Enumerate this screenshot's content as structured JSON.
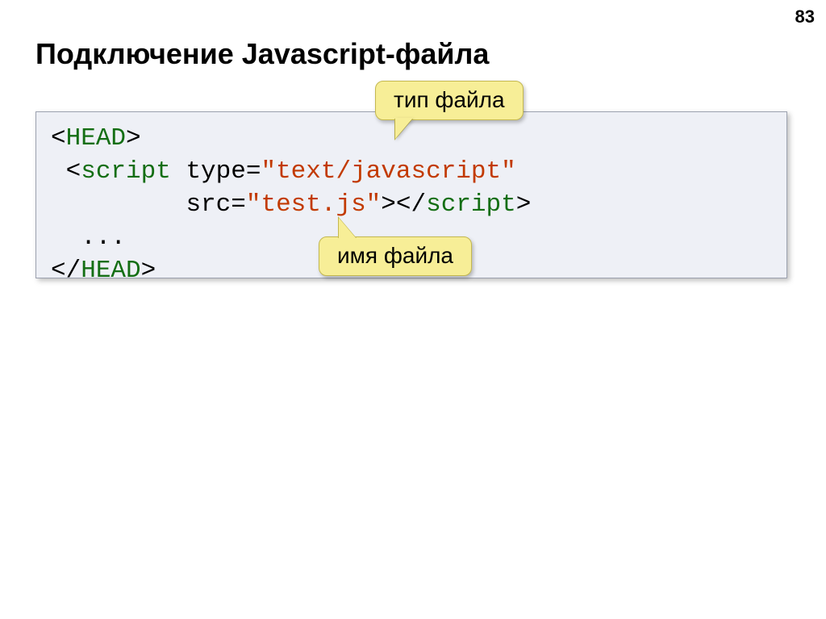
{
  "page_number": "83",
  "title": "Подключение Javascript-файла",
  "callouts": {
    "type_label": "тип файла",
    "name_label": "имя файла"
  },
  "code": {
    "lt": "<",
    "gt": ">",
    "slash": "/",
    "head": "HEAD",
    "script": "script",
    "type_attr": " type=",
    "type_val": "\"text/javascript\"",
    "src_attr": "src=",
    "src_val": "\"test.js\"",
    "ellipsis": "  ...",
    "indent1": " ",
    "indent2": "         "
  }
}
